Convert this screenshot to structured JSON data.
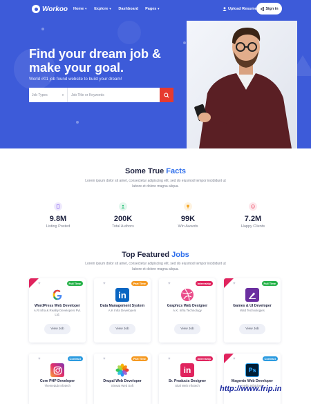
{
  "brand": {
    "name": "Workoo"
  },
  "nav": {
    "items": [
      {
        "label": "Home",
        "has_caret": true
      },
      {
        "label": "Explore",
        "has_caret": true
      },
      {
        "label": "Dashboard",
        "has_caret": false
      },
      {
        "label": "Pages",
        "has_caret": true
      }
    ],
    "upload_label": "Upload Resume",
    "signin_label": "Sign in"
  },
  "hero": {
    "title_line1": "Find your dream job &",
    "title_line2": "make your goal.",
    "subtitle": "World #01 job found website to build your dream!",
    "search": {
      "type_placeholder": "Job Types",
      "keyword_placeholder": "Job Title or Keywords"
    }
  },
  "facts": {
    "title_main": "Some True ",
    "title_highlight": "Facts",
    "desc_line1": "Lorem ipsum dolor sit amet, consectetur adipiscing elit, sed do eiusmod tempor incididunt ut",
    "desc_line2": "labore et dolore magna aliqua.",
    "stats": [
      {
        "value": "9.8M",
        "label": "Listing Posted",
        "icon": "document-icon",
        "color": "#8f6cf0"
      },
      {
        "value": "200K",
        "label": "Total Authors",
        "icon": "user-icon",
        "color": "#2fc27a"
      },
      {
        "value": "99K",
        "label": "Win Awards",
        "icon": "trophy-icon",
        "color": "#f5a623"
      },
      {
        "value": "7.2M",
        "label": "Happy Clients",
        "icon": "smile-icon",
        "color": "#f0647a"
      }
    ]
  },
  "jobs": {
    "title_main": "Top Featured ",
    "title_highlight": "Jobs",
    "desc_line1": "Lorem ipsum dolor sit amet, consectetur adipiscing elit, sed do eiusmod tempor incididunt ut",
    "desc_line2": "labore et dolore magna aliqua.",
    "view_label": "View Job",
    "cards": [
      {
        "title": "WordPress Web Developer",
        "company": "A.R Infra & Reality Developers Pvt. Ltd.",
        "badge": "Full Time",
        "badge_color": "#27b24a",
        "logo": "google-logo"
      },
      {
        "title": "Data Management System",
        "company": "A.K Infra Developers",
        "badge": "Part Time",
        "badge_color": "#f59a23",
        "logo": "linkedin-logo"
      },
      {
        "title": "Graphics Web Designer",
        "company": "A.K. Infra Technology",
        "badge": "Internship",
        "badge_color": "#e0245e",
        "logo": "dribbble-logo"
      },
      {
        "title": "Games & UI Developer",
        "company": "Watt Technologies",
        "badge": "Full Time",
        "badge_color": "#27b24a",
        "logo": "design-pen-logo"
      },
      {
        "title": "Core PHP Developer",
        "company": "Themedub Infotech",
        "badge": "Contract",
        "badge_color": "#2c9be0",
        "logo": "instagram-logo"
      },
      {
        "title": "Drupal Web Developer",
        "company": "Sinwat Web Soft",
        "badge": "Part Time",
        "badge_color": "#f59a23",
        "logo": "photos-logo"
      },
      {
        "title": "Sr. Products Designer",
        "company": "Sital Web Infotech",
        "badge": "Internship",
        "badge_color": "#e0245e",
        "logo": "invision-logo"
      },
      {
        "title": "Magento Web Developer",
        "company": "Hello Infotches",
        "badge": "Contract",
        "badge_color": "#2c9be0",
        "logo": "photoshop-logo"
      }
    ]
  },
  "watermark": "http://www.frip.in"
}
